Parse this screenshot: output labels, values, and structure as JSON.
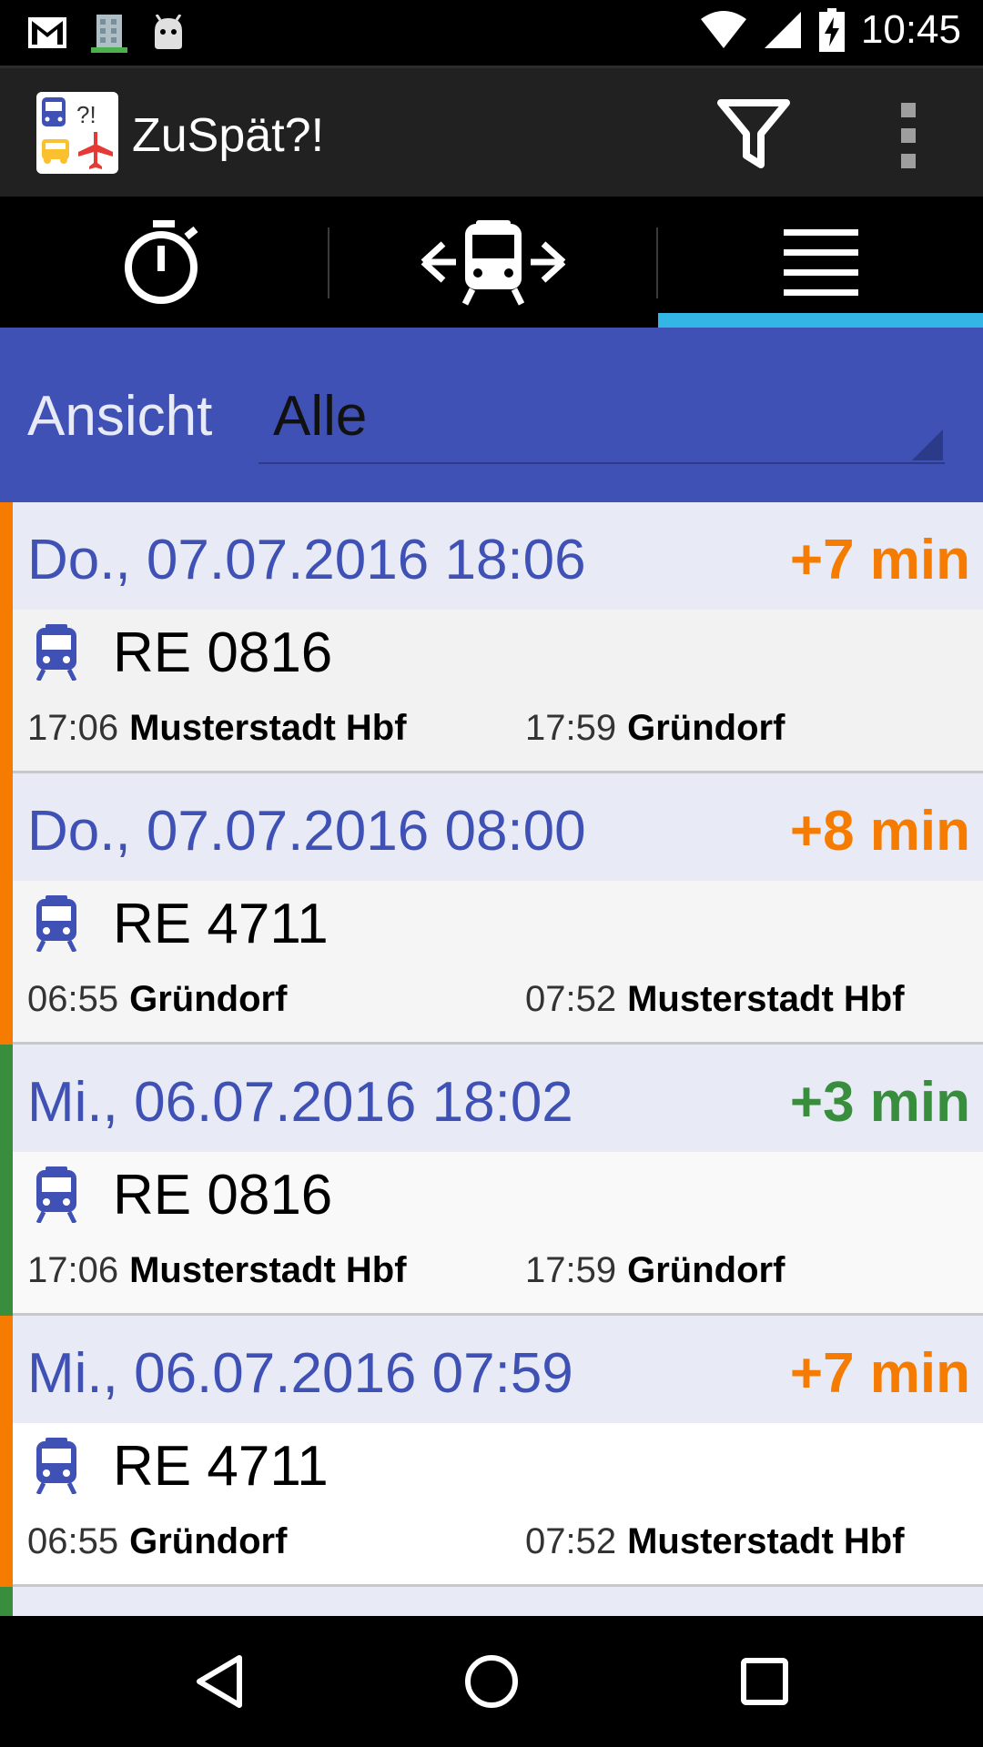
{
  "status_bar": {
    "time": "10:45",
    "left_icons": [
      "gmail-icon",
      "building-icon",
      "android-icon"
    ],
    "right_icons": [
      "wifi-icon",
      "signal-icon",
      "battery-charging-icon"
    ]
  },
  "action_bar": {
    "title": "ZuSpät?!",
    "actions": [
      "filter-icon",
      "overflow-menu-icon"
    ]
  },
  "tabs": [
    {
      "name": "stopwatch-icon",
      "selected": false
    },
    {
      "name": "train-route-icon",
      "selected": false
    },
    {
      "name": "list-icon",
      "selected": true
    }
  ],
  "view_selector": {
    "label": "Ansicht",
    "value": "Alle"
  },
  "colors": {
    "accent": "#3f51b5",
    "tab_indicator": "#33b5e5",
    "late_orange": "#f57c00",
    "late_green": "#388e3c",
    "header_bg": "#e8eaf6"
  },
  "entries": [
    {
      "date": "Do., 07.07.2016 18:06",
      "delay": "+7 min",
      "status_color": "#f57c00",
      "body_bg": "#f2f2f2",
      "train": "RE 0816",
      "departure": {
        "time": "17:06",
        "station": "Musterstadt Hbf"
      },
      "arrival": {
        "time": "17:59",
        "station": "Gründorf"
      }
    },
    {
      "date": "Do., 07.07.2016 08:00",
      "delay": "+8 min",
      "status_color": "#f57c00",
      "body_bg": "#f5f5f5",
      "train": "RE 4711",
      "departure": {
        "time": "06:55",
        "station": "Gründorf"
      },
      "arrival": {
        "time": "07:52",
        "station": "Musterstadt Hbf"
      }
    },
    {
      "date": "Mi., 06.07.2016 18:02",
      "delay": "+3 min",
      "status_color": "#388e3c",
      "body_bg": "#f9f9f9",
      "train": "RE 0816",
      "departure": {
        "time": "17:06",
        "station": "Musterstadt Hbf"
      },
      "arrival": {
        "time": "17:59",
        "station": "Gründorf"
      }
    },
    {
      "date": "Mi., 06.07.2016 07:59",
      "delay": "+7 min",
      "status_color": "#f57c00",
      "body_bg": "#ffffff",
      "train": "RE 4711",
      "departure": {
        "time": "06:55",
        "station": "Gründorf"
      },
      "arrival": {
        "time": "07:52",
        "station": "Musterstadt Hbf"
      }
    }
  ],
  "nav_bar": [
    "back-icon",
    "home-icon",
    "recents-icon"
  ]
}
